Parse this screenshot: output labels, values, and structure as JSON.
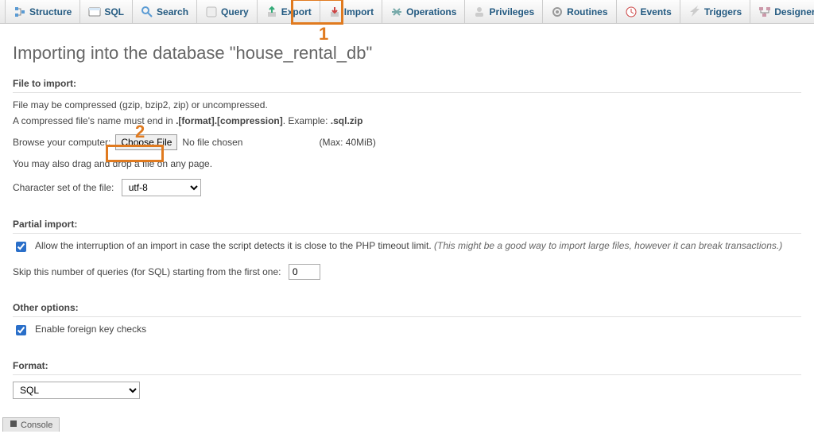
{
  "nav": {
    "tabs": [
      {
        "label": "Structure",
        "icon": "structure"
      },
      {
        "label": "SQL",
        "icon": "sql"
      },
      {
        "label": "Search",
        "icon": "search"
      },
      {
        "label": "Query",
        "icon": "query"
      },
      {
        "label": "Export",
        "icon": "export"
      },
      {
        "label": "Import",
        "icon": "import"
      },
      {
        "label": "Operations",
        "icon": "operations"
      },
      {
        "label": "Privileges",
        "icon": "privileges"
      },
      {
        "label": "Routines",
        "icon": "routines"
      },
      {
        "label": "Events",
        "icon": "events"
      },
      {
        "label": "Triggers",
        "icon": "triggers"
      },
      {
        "label": "Designer",
        "icon": "designer"
      }
    ]
  },
  "page_title": "Importing into the database \"house_rental_db\"",
  "file_import": {
    "heading": "File to import:",
    "hint1": "File may be compressed (gzip, bzip2, zip) or uncompressed.",
    "hint2a": "A compressed file's name must end in ",
    "hint2b": ".[format].[compression]",
    "hint2c": ". Example: ",
    "hint2d": ".sql.zip",
    "browse_label": "Browse your computer:",
    "choose_button": "Choose File",
    "no_file": "No file chosen",
    "max_size": "(Max: 40MiB)",
    "drag_hint": "You may also drag and drop a file on any page.",
    "charset_label": "Character set of the file:",
    "charset_value": "utf-8"
  },
  "partial": {
    "heading": "Partial import:",
    "allow_label_a": "Allow the interruption of an import in case the script detects it is close to the PHP timeout limit. ",
    "allow_label_b": "(This might be a good way to import large files, however it can break transactions.)",
    "skip_label": "Skip this number of queries (for SQL) starting from the first one:",
    "skip_value": "0"
  },
  "other": {
    "heading": "Other options:",
    "fk_label": "Enable foreign key checks"
  },
  "format": {
    "heading": "Format:",
    "value": "SQL"
  },
  "console_label": "Console",
  "annotations": {
    "n1": "1",
    "n2": "2"
  }
}
